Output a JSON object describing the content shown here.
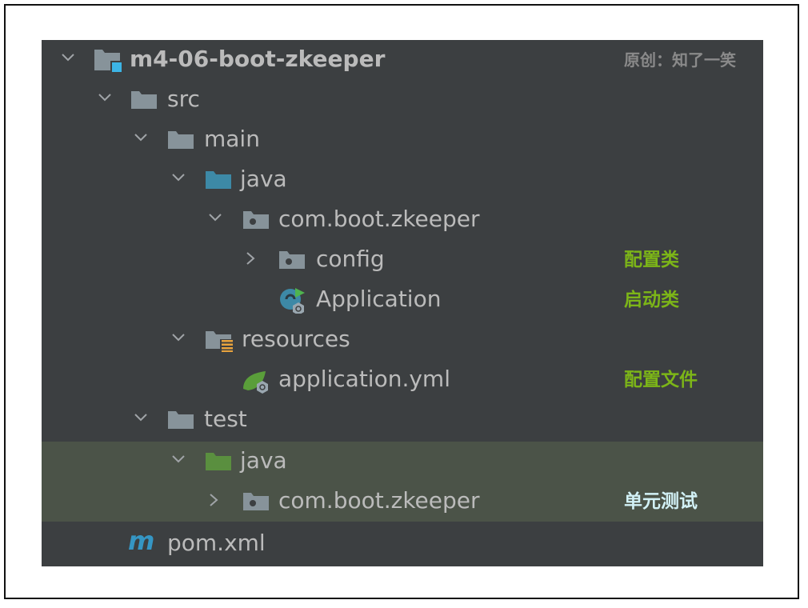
{
  "watermark": "原创：知了一笑",
  "colors": {
    "panel_bg": "#3c3f41",
    "highlight_bg": "#4b5348",
    "text": "#bbbbbb",
    "note_green": "#7cb518",
    "note_cyan": "#d2f1f6",
    "folder_gray": "#87939a",
    "folder_blue": "#3d89a6",
    "folder_green": "#5a8f3f",
    "module_badge": "#3cb4e5",
    "maven_blue": "#3596c4"
  },
  "tree": [
    {
      "label": "m4-06-boot-zkeeper",
      "icon": "module-folder-icon",
      "expanded": true
    },
    {
      "label": "src",
      "icon": "folder-icon",
      "expanded": true
    },
    {
      "label": "main",
      "icon": "folder-icon",
      "expanded": true
    },
    {
      "label": "java",
      "icon": "source-folder-icon",
      "expanded": true
    },
    {
      "label": "com.boot.zkeeper",
      "icon": "package-icon",
      "expanded": true
    },
    {
      "label": "config",
      "icon": "package-icon",
      "expanded": false,
      "note": "配置类"
    },
    {
      "label": "Application",
      "icon": "spring-boot-class-icon",
      "note": "启动类"
    },
    {
      "label": "resources",
      "icon": "resources-folder-icon",
      "expanded": true
    },
    {
      "label": "application.yml",
      "icon": "spring-yml-icon",
      "note": "配置文件"
    },
    {
      "label": "test",
      "icon": "folder-icon",
      "expanded": true
    },
    {
      "label": "java",
      "icon": "test-folder-icon",
      "expanded": true
    },
    {
      "label": "com.boot.zkeeper",
      "icon": "package-icon",
      "expanded": false,
      "note": "单元测试"
    },
    {
      "label": "pom.xml",
      "icon": "maven-icon"
    }
  ]
}
